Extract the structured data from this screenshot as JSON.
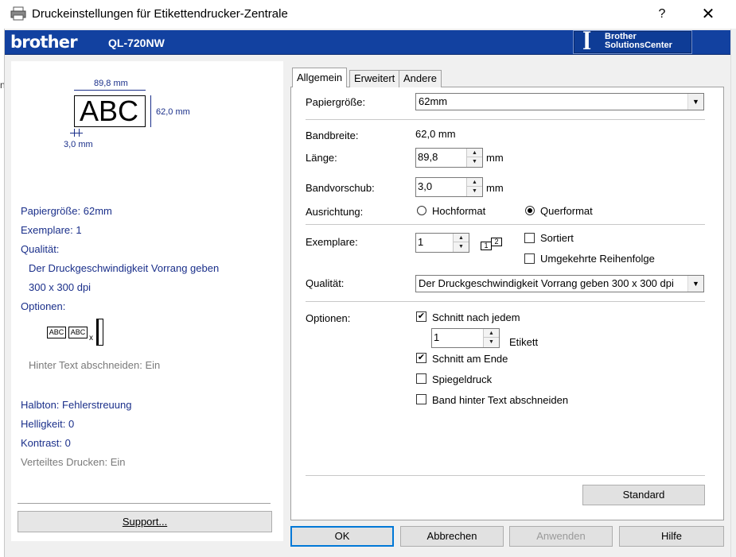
{
  "window": {
    "title": "Druckeinstellungen für Etikettendrucker-Zentrale",
    "help_glyph": "?",
    "close_glyph": "✕",
    "left_edge_text": "n"
  },
  "brand": {
    "logo": "brother",
    "model": "QL-720NW",
    "solutions_center": [
      "Brother",
      "SolutionsCenter"
    ],
    "colors": {
      "bar": "#1241a0",
      "text": "#ffffff",
      "summary_text": "#1a2f8a"
    }
  },
  "preview": {
    "sample_text": "ABC",
    "width_label": "89,8 mm",
    "height_label": "62,0 mm",
    "feed_label": "3,0 mm"
  },
  "summary": {
    "paper_size": "Papiergröße: 62mm",
    "copies": "Exemplare: 1",
    "quality_label": "Qualität:",
    "quality_value": "Der Druckgeschwindigkeit Vorrang geben",
    "resolution": "300 x 300 dpi",
    "options_label": "Optionen:",
    "options_icon_labels": [
      "ABC",
      "ABC"
    ],
    "options_x": "x",
    "trim_text": "Hinter Text abschneiden: Ein",
    "halftone": "Halbton: Fehlerstreuung",
    "brightness": "Helligkeit:  0",
    "contrast": "Kontrast:  0",
    "distributed": "Verteiltes Drucken: Ein",
    "support_button": "Support..."
  },
  "tabs": [
    {
      "label": "Allgemein",
      "active": true
    },
    {
      "label": "Erweitert",
      "active": false
    },
    {
      "label": "Andere",
      "active": false
    }
  ],
  "general": {
    "paper_size_label": "Papiergröße:",
    "paper_size_value": "62mm",
    "tape_width_label": "Bandbreite:",
    "tape_width_value": "62,0 mm",
    "length_label": "Länge:",
    "length_value": "89,8",
    "length_unit": "mm",
    "feed_label": "Bandvorschub:",
    "feed_value": "3,0",
    "feed_unit": "mm",
    "orientation_label": "Ausrichtung:",
    "orientation_options": [
      {
        "label": "Hochformat",
        "selected": false
      },
      {
        "label": "Querformat",
        "selected": true
      }
    ],
    "copies_label": "Exemplare:",
    "copies_value": "1",
    "collate_icon_labels": [
      "1",
      "2"
    ],
    "sorted_label": "Sortiert",
    "sorted_checked": false,
    "reverse_label": "Umgekehrte Reihenfolge",
    "reverse_checked": false,
    "quality_label": "Qualität:",
    "quality_value": "Der Druckgeschwindigkeit Vorrang geben 300 x 300 dpi",
    "options_label": "Optionen:",
    "cut_each_label": "Schnitt nach jedem",
    "cut_each_checked": true,
    "cut_each_value": "1",
    "cut_each_unit": "Etikett",
    "cut_end_label": "Schnitt am Ende",
    "cut_end_checked": true,
    "mirror_label": "Spiegeldruck",
    "mirror_checked": false,
    "trim_label": "Band hinter Text abschneiden",
    "trim_checked": false,
    "standard_button": "Standard"
  },
  "footer": {
    "ok": "OK",
    "cancel": "Abbrechen",
    "apply": "Anwenden",
    "help": "Hilfe"
  }
}
